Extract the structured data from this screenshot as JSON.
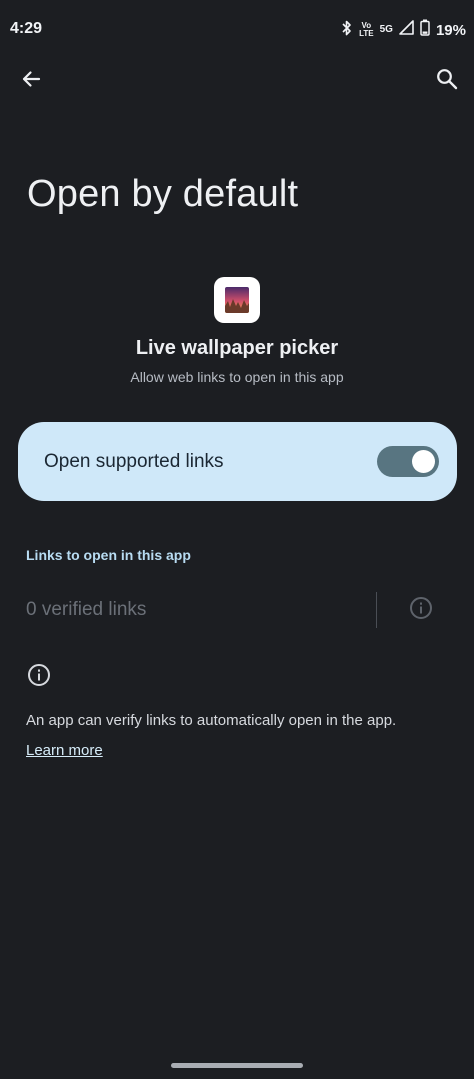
{
  "status_bar": {
    "time": "4:29",
    "volte_top": "Vo",
    "volte_bottom": "LTE",
    "network": "5G",
    "battery": "19%",
    "icons": [
      "bluetooth-icon",
      "volte-icon",
      "5g-icon",
      "signal-icon",
      "battery-icon"
    ]
  },
  "app_bar": {
    "back_icon": "back-arrow-icon",
    "search_icon": "search-icon"
  },
  "page": {
    "title": "Open by default"
  },
  "app": {
    "name": "Live wallpaper picker",
    "subtitle": "Allow web links to open in this app"
  },
  "toggle": {
    "label": "Open supported links",
    "state": "on"
  },
  "links_section": {
    "label": "Links to open in this app",
    "verified_text": "0 verified links"
  },
  "footer": {
    "info_text": "An app can verify links to automatically open in the app.",
    "learn_more": "Learn more"
  },
  "colors": {
    "background": "#1c1e22",
    "card": "#cfe8f9",
    "switch_track": "#587581",
    "accent_label": "#b8dcf2"
  }
}
